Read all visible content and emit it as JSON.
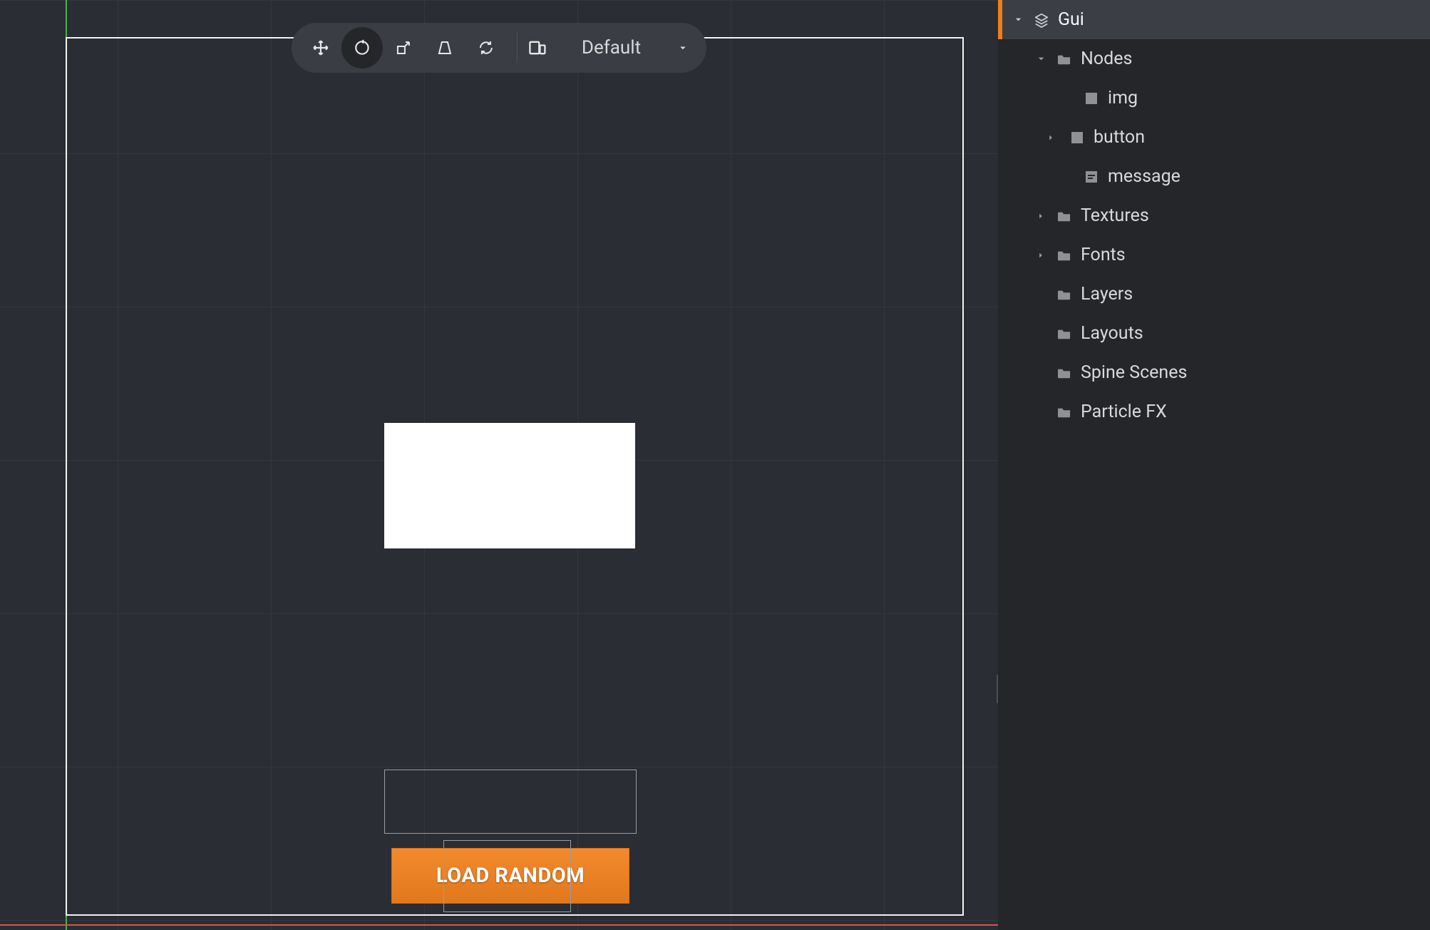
{
  "toolbar": {
    "layout_label": "Default"
  },
  "scene": {
    "button_label": "LOAD RANDOM"
  },
  "outline": {
    "gui": "Gui",
    "nodes": "Nodes",
    "img": "img",
    "button": "button",
    "message": "message",
    "textures": "Textures",
    "fonts": "Fonts",
    "layers": "Layers",
    "layouts": "Layouts",
    "spine": "Spine Scenes",
    "particle": "Particle FX"
  }
}
